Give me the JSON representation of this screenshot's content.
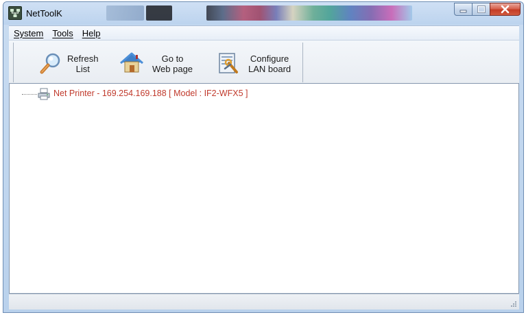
{
  "window": {
    "title": "NetToolK"
  },
  "menu": {
    "items": [
      "System",
      "Tools",
      "Help"
    ]
  },
  "toolbar": {
    "refresh_label": "Refresh\nList",
    "goto_label": "Go to\nWeb page",
    "configure_label": "Configure\nLAN board"
  },
  "tree": {
    "items": [
      {
        "label": "Net Printer - 169.254.169.188 [ Model : IF2-WFX5 ]",
        "icon": "printer-icon"
      }
    ]
  },
  "colors": {
    "tree_item_text": "#c0392b",
    "titlebar": "#bcd3ee",
    "close_button": "#c43c25"
  }
}
